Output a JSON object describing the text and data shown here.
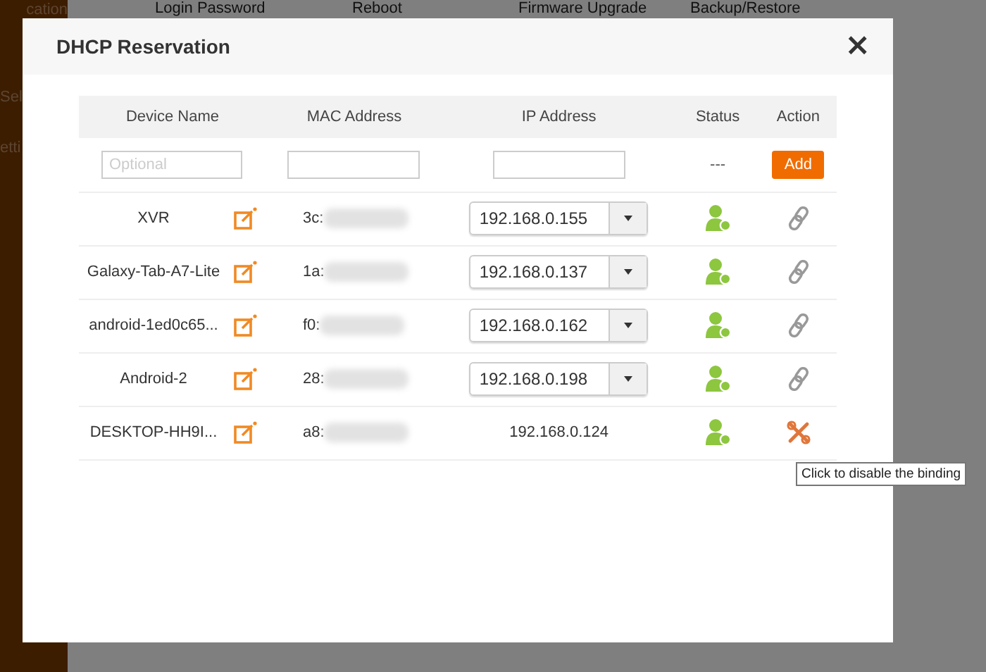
{
  "background": {
    "nav_items": [
      "Login Password",
      "Reboot",
      "Firmware Upgrade",
      "Backup/Restore"
    ],
    "sidebar_items": [
      "cation",
      "Sel",
      "etti"
    ]
  },
  "dialog": {
    "title": "DHCP Reservation",
    "close": "×"
  },
  "table": {
    "columns": [
      "Device Name",
      "MAC Address",
      "IP Address",
      "Status",
      "Action"
    ],
    "new_row": {
      "name_placeholder": "Optional",
      "status": "---",
      "add_button": "Add"
    },
    "rows": [
      {
        "name": "XVR",
        "mac": "3c:",
        "ip": "192.168.0.155",
        "ip_editable": true,
        "hovered": false
      },
      {
        "name": "Galaxy-Tab-A7-Lite",
        "mac": "1a:",
        "ip": "192.168.0.137",
        "ip_editable": true,
        "hovered": false
      },
      {
        "name": "android-1ed0c65...",
        "mac": "f0:",
        "ip": "192.168.0.162",
        "ip_editable": true,
        "hovered": false
      },
      {
        "name": "Android-2",
        "mac": "28:",
        "ip": "192.168.0.198",
        "ip_editable": true,
        "hovered": false
      },
      {
        "name": "DESKTOP-HH9I...",
        "mac": "a8:",
        "ip": "192.168.0.124",
        "ip_editable": false,
        "hovered": true
      }
    ]
  },
  "tooltip": "Click to disable the binding"
}
